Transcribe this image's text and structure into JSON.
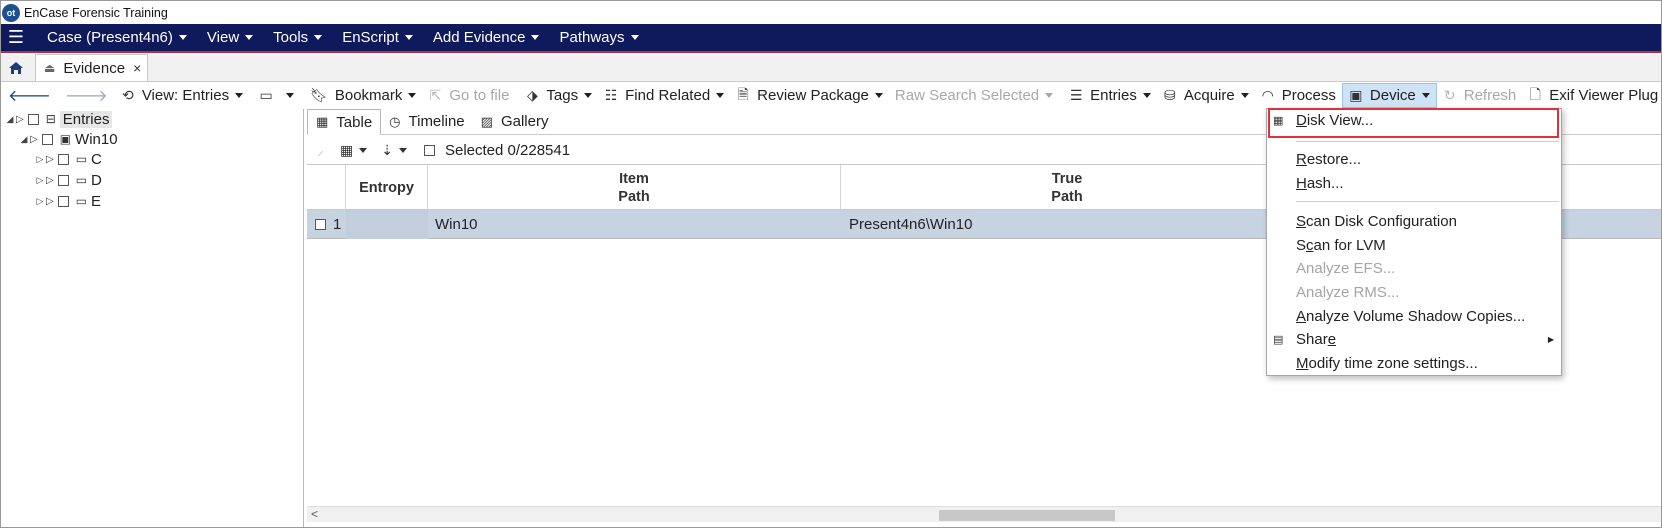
{
  "app": {
    "title": "EnCase Forensic Training",
    "logo_text": "ot"
  },
  "menubar": {
    "items": [
      "Case (Present4n6)",
      "View",
      "Tools",
      "EnScript",
      "Add Evidence",
      "Pathways"
    ]
  },
  "tabs": {
    "active": "Evidence",
    "close_symbol": "×"
  },
  "toolbar": {
    "view_entries": "View: Entries",
    "bookmark": "Bookmark",
    "go_to_file": "Go to file",
    "tags": "Tags",
    "find_related": "Find Related",
    "review_package": "Review Package",
    "raw_search_selected": "Raw Search Selected",
    "entries": "Entries",
    "acquire": "Acquire",
    "process": "Process",
    "device": "Device",
    "refresh": "Refresh",
    "exif_viewer": "Exif Viewer Plug"
  },
  "tree": {
    "root": "Entries",
    "device": "Win10",
    "volumes": [
      "C",
      "D",
      "E"
    ]
  },
  "view_tabs": [
    "Table",
    "Timeline",
    "Gallery"
  ],
  "subbar": {
    "selected": "Selected 0/228541"
  },
  "table": {
    "columns": {
      "entropy": "Entropy",
      "item_path_1": "Item",
      "item_path_2": "Path",
      "true_path_1": "True",
      "true_path_2": "Path"
    },
    "rows": [
      {
        "num": "1",
        "entropy": "",
        "item_path": "Win10",
        "true_path": "Present4n6\\Win10"
      }
    ]
  },
  "device_menu": {
    "disk_view": {
      "u": "D",
      "rest": "isk View..."
    },
    "restore": {
      "u": "R",
      "rest": "estore..."
    },
    "hash": {
      "u": "H",
      "rest": "ash..."
    },
    "scan_disk": {
      "u": "S",
      "rest": "can Disk Configuration"
    },
    "scan_lvm": {
      "pre": "S",
      "u": "c",
      "rest": "an for LVM"
    },
    "analyze_efs": "Analyze EFS...",
    "analyze_rms": "Analyze RMS...",
    "analyze_vsc": {
      "u": "A",
      "rest": "nalyze Volume Shadow Copies..."
    },
    "share": {
      "pre": "Shar",
      "u": "e"
    },
    "modify_tz": {
      "u": "M",
      "rest": "odify time zone settings..."
    }
  },
  "colors": {
    "menubar_bg": "#0e1a5c",
    "menubar_accent": "#c0283c",
    "row_selected": "#c8d3e2",
    "highlight_box": "#e0303a"
  }
}
